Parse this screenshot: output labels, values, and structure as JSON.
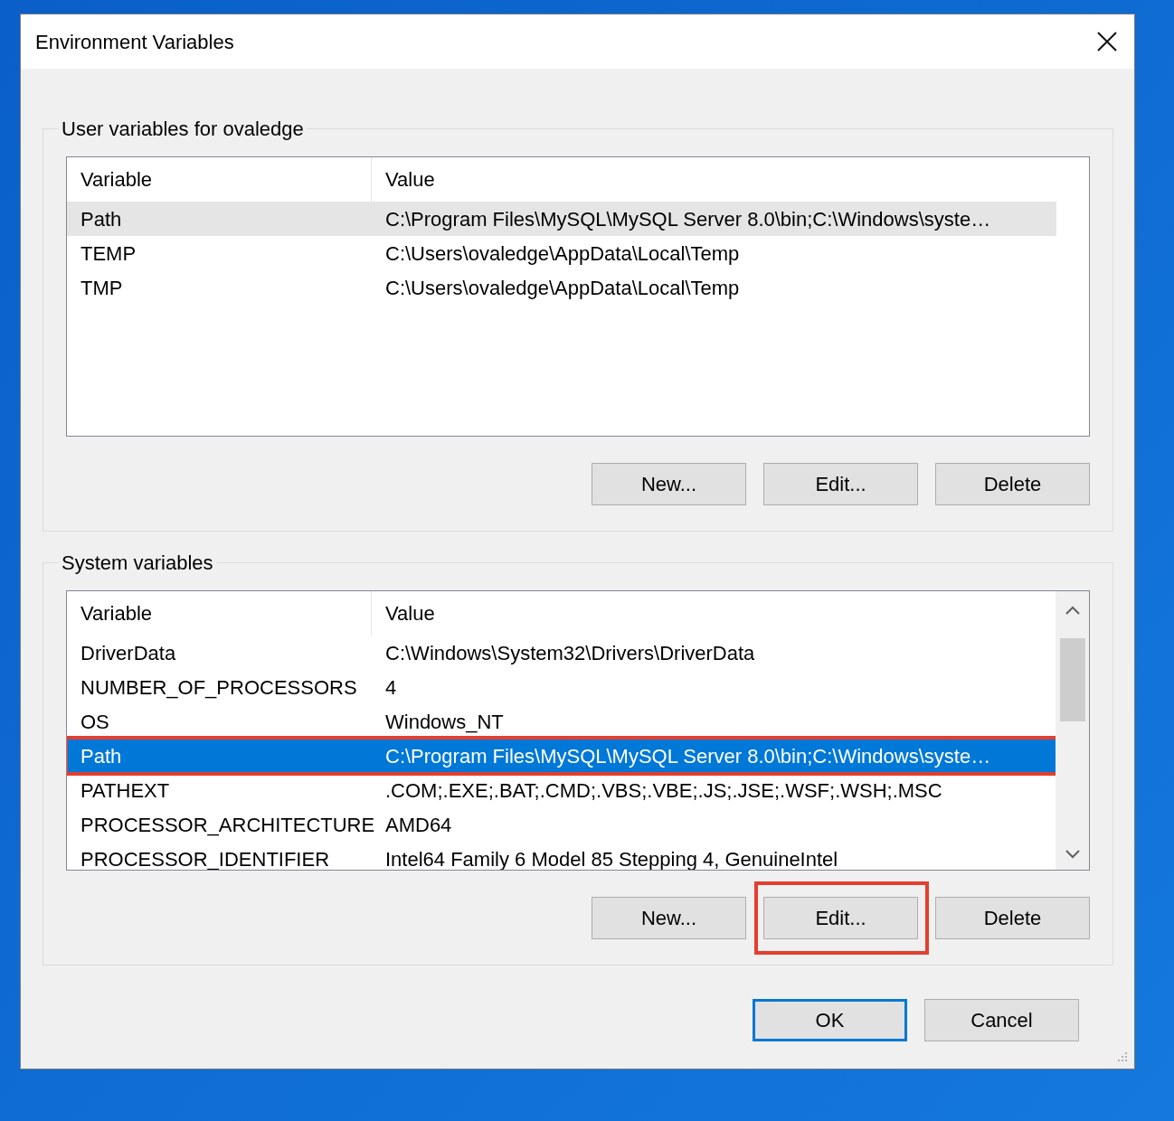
{
  "window": {
    "title": "Environment Variables"
  },
  "sections": [
    {
      "title": "User variables for ovaledge",
      "focused": false,
      "scrollable": false,
      "columns": [
        "Variable",
        "Value"
      ],
      "rows": [
        {
          "variable": "Path",
          "value": "C:\\Program Files\\MySQL\\MySQL Server 8.0\\bin;C:\\Windows\\syste…",
          "selected": true,
          "highlighted": false
        },
        {
          "variable": "TEMP",
          "value": "C:\\Users\\ovaledge\\AppData\\Local\\Temp",
          "selected": false,
          "highlighted": false
        },
        {
          "variable": "TMP",
          "value": "C:\\Users\\ovaledge\\AppData\\Local\\Temp",
          "selected": false,
          "highlighted": false
        }
      ],
      "buttons": [
        {
          "label": "New...",
          "highlighted": false
        },
        {
          "label": "Edit...",
          "highlighted": false
        },
        {
          "label": "Delete",
          "highlighted": false
        }
      ]
    },
    {
      "title": "System variables",
      "focused": true,
      "scrollable": true,
      "columns": [
        "Variable",
        "Value"
      ],
      "rows": [
        {
          "variable": "DriverData",
          "value": "C:\\Windows\\System32\\Drivers\\DriverData",
          "selected": false,
          "highlighted": false
        },
        {
          "variable": "NUMBER_OF_PROCESSORS",
          "value": "4",
          "selected": false,
          "highlighted": false
        },
        {
          "variable": "OS",
          "value": "Windows_NT",
          "selected": false,
          "highlighted": false
        },
        {
          "variable": "Path",
          "value": "C:\\Program Files\\MySQL\\MySQL Server 8.0\\bin;C:\\Windows\\syste…",
          "selected": true,
          "highlighted": true
        },
        {
          "variable": "PATHEXT",
          "value": ".COM;.EXE;.BAT;.CMD;.VBS;.VBE;.JS;.JSE;.WSF;.WSH;.MSC",
          "selected": false,
          "highlighted": false
        },
        {
          "variable": "PROCESSOR_ARCHITECTURE",
          "value": "AMD64",
          "selected": false,
          "highlighted": false
        },
        {
          "variable": "PROCESSOR_IDENTIFIER",
          "value": "Intel64 Family 6 Model 85 Stepping 4, GenuineIntel",
          "selected": false,
          "highlighted": false
        }
      ],
      "buttons": [
        {
          "label": "New...",
          "highlighted": false
        },
        {
          "label": "Edit...",
          "highlighted": true
        },
        {
          "label": "Delete",
          "highlighted": false
        }
      ]
    }
  ],
  "footer_buttons": [
    {
      "label": "OK",
      "default": true
    },
    {
      "label": "Cancel",
      "default": false
    }
  ]
}
